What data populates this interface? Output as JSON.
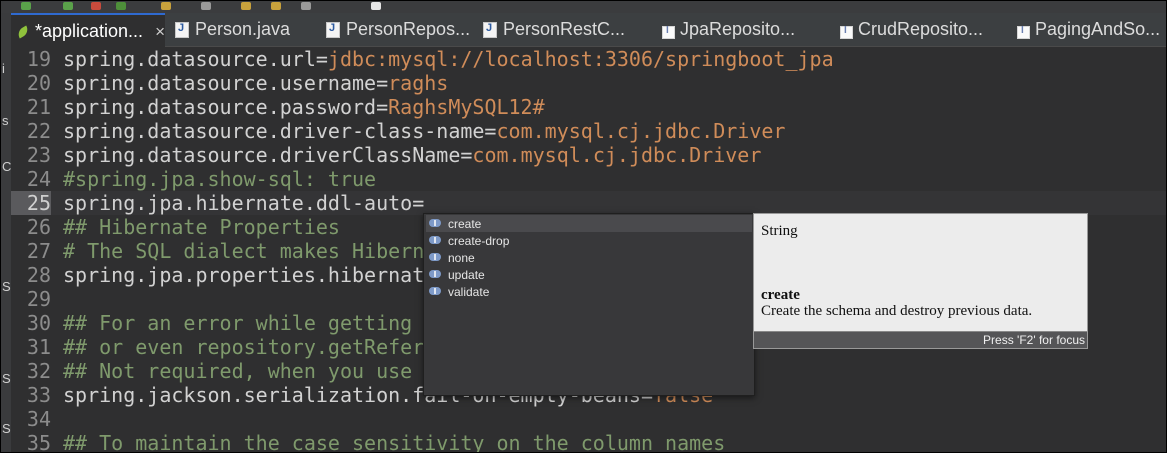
{
  "tabs": [
    {
      "label": "*application...",
      "icon": "spring-leaf-icon",
      "close": "×",
      "active": true
    },
    {
      "label": "Person.java",
      "icon": "java-file-icon"
    },
    {
      "label": "PersonRepos...",
      "icon": "java-file-icon"
    },
    {
      "label": "PersonRestC...",
      "icon": "java-file-icon"
    },
    {
      "label": "JpaReposito...",
      "icon": "library-class-icon"
    },
    {
      "label": "CrudReposito...",
      "icon": "library-class-icon"
    },
    {
      "label": "PagingAndSo...",
      "icon": "library-class-icon"
    }
  ],
  "left_fragments": [
    "i",
    "s",
    "C",
    "S",
    "S",
    "S"
  ],
  "lines": [
    {
      "num": "19",
      "key": "spring.datasource.url=",
      "value": "jdbc:mysql://localhost:3306/springboot_jpa"
    },
    {
      "num": "20",
      "key": "spring.datasource.username=",
      "value": "raghs"
    },
    {
      "num": "21",
      "key": "spring.datasource.password=",
      "value": "RaghsMySQL12#"
    },
    {
      "num": "22",
      "key": "spring.datasource.driver-class-name=",
      "value": "com.mysql.cj.jdbc.Driver"
    },
    {
      "num": "23",
      "key": "spring.datasource.driverClassName=",
      "value": "com.mysql.cj.jdbc.Driver"
    },
    {
      "num": "24",
      "comment": "#spring.jpa.show-sql: true"
    },
    {
      "num": "25",
      "key": "spring.jpa.hibernate.ddl-auto=",
      "value": "",
      "current": true
    },
    {
      "num": "26",
      "comment": "## Hibernate Properties"
    },
    {
      "num": "27",
      "comment": "# The SQL dialect makes Hibern"
    },
    {
      "num": "28",
      "key": "spring.jpa.properties.hibernat",
      "value": ""
    },
    {
      "num": "29",
      "key": "",
      "value": ""
    },
    {
      "num": "30",
      "comment": "## For an error while getting"
    },
    {
      "num": "31",
      "comment": "## or even repository.getRefer"
    },
    {
      "num": "32",
      "comment": "## Not required, when you use"
    },
    {
      "num": "33",
      "key": "spring.jackson.serialization.fail-on-empty-beans=",
      "value": "false"
    },
    {
      "num": "34",
      "key": "",
      "value": ""
    },
    {
      "num": "35",
      "comment": "## To maintain the case sensitivity on the column names"
    }
  ],
  "completion": {
    "items": [
      "create",
      "create-drop",
      "none",
      "update",
      "validate"
    ],
    "selected": 0,
    "icon": "property-value-icon"
  },
  "doc": {
    "type": "String",
    "name": "create",
    "description": "Create the schema and destroy previous data.",
    "footer": "Press 'F2' for focus"
  },
  "colors": {
    "background": "#2f2f30",
    "key": "#d2d2d2",
    "value": "#d08c59",
    "comment": "#7f9a6c",
    "active_tab_accent": "#2f6ad0"
  }
}
